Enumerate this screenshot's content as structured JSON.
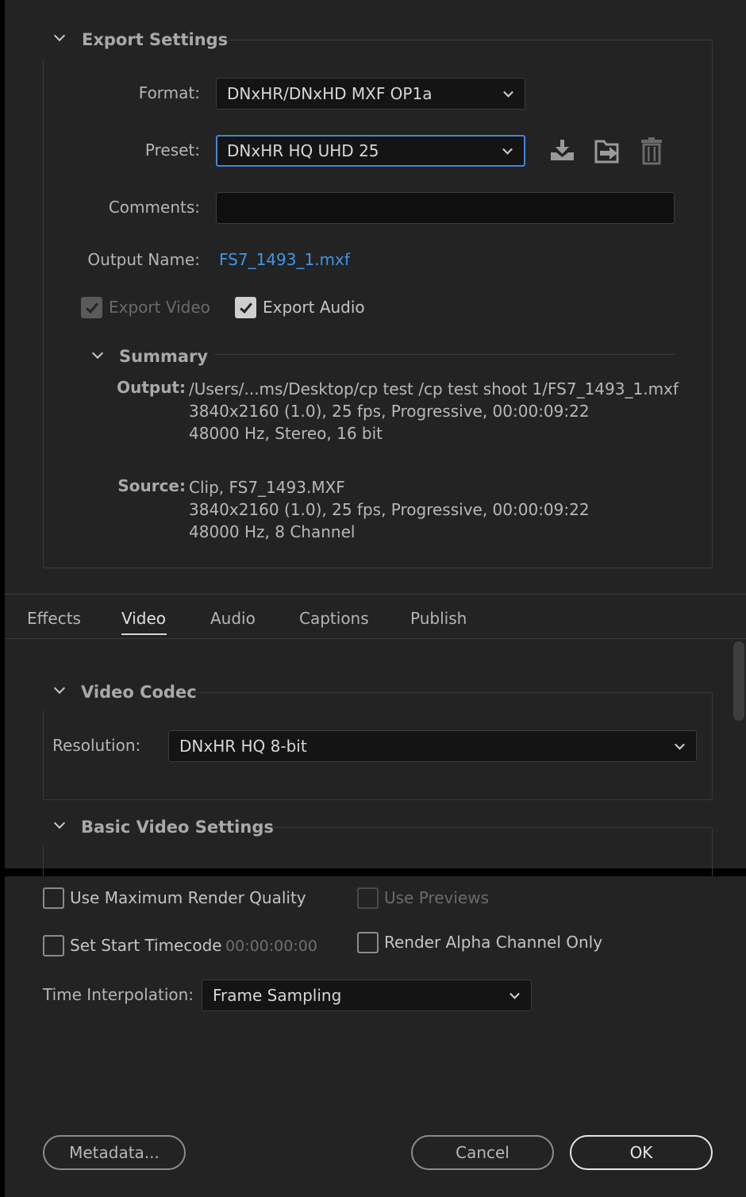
{
  "export_settings": {
    "title": "Export Settings",
    "format_label": "Format:",
    "format_value": "DNxHR/DNxHD MXF OP1a",
    "preset_label": "Preset:",
    "preset_value": "DNxHR HQ UHD 25",
    "comments_label": "Comments:",
    "comments_value": "",
    "output_name_label": "Output Name:",
    "output_name_value": "FS7_1493_1.mxf",
    "export_video": {
      "label": "Export Video",
      "checked": true,
      "disabled": true
    },
    "export_audio": {
      "label": "Export Audio",
      "checked": true,
      "disabled": false
    },
    "preset_icons": [
      "save-preset-icon",
      "import-preset-icon",
      "delete-preset-icon"
    ]
  },
  "summary": {
    "title": "Summary",
    "output_key": "Output:",
    "output_lines": [
      "/Users/...ms/Desktop/cp test /cp test shoot 1/FS7_1493_1.mxf",
      "3840x2160 (1.0), 25 fps, Progressive, 00:00:09:22",
      "48000 Hz, Stereo, 16 bit"
    ],
    "source_key": "Source:",
    "source_lines": [
      "Clip, FS7_1493.MXF",
      "3840x2160 (1.0), 25 fps, Progressive, 00:00:09:22",
      "48000 Hz, 8 Channel"
    ]
  },
  "tabs": [
    {
      "label": "Effects",
      "active": false
    },
    {
      "label": "Video",
      "active": true
    },
    {
      "label": "Audio",
      "active": false
    },
    {
      "label": "Captions",
      "active": false
    },
    {
      "label": "Publish",
      "active": false
    }
  ],
  "video_codec": {
    "title": "Video Codec",
    "resolution_label": "Resolution:",
    "resolution_value": "DNxHR HQ 8-bit"
  },
  "basic_video_settings": {
    "title": "Basic Video Settings"
  },
  "render_options": {
    "max_render_quality": {
      "label": "Use Maximum Render Quality",
      "checked": false
    },
    "use_previews": {
      "label": "Use Previews",
      "checked": false,
      "disabled": true
    },
    "set_start_timecode": {
      "label": "Set Start Timecode",
      "checked": false,
      "timecode": "00:00:00:00"
    },
    "render_alpha": {
      "label": "Render Alpha Channel Only",
      "checked": false
    },
    "time_interpolation_label": "Time Interpolation:",
    "time_interpolation_value": "Frame Sampling"
  },
  "buttons": {
    "metadata": "Metadata...",
    "cancel": "Cancel",
    "ok": "OK"
  },
  "colors": {
    "background": "#232323",
    "accent": "#3d89d6",
    "link": "#3d96e6"
  }
}
